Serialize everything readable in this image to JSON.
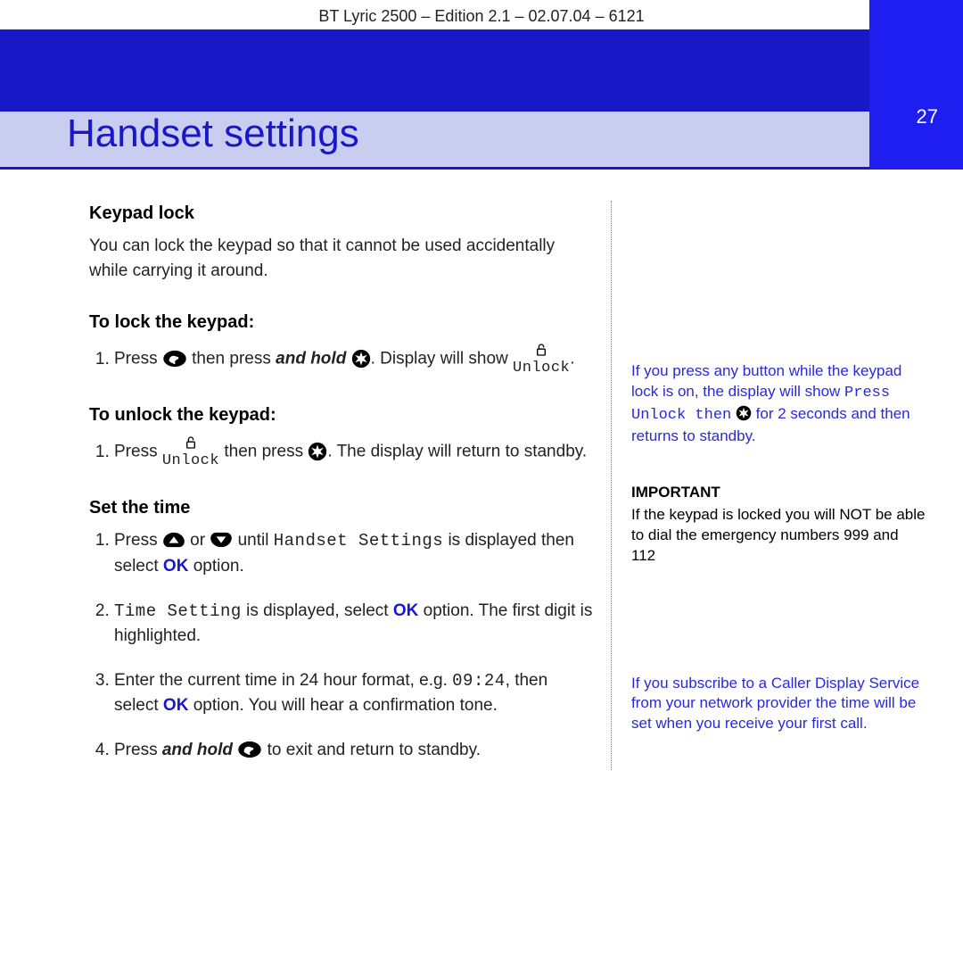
{
  "header_meta": "BT Lyric 2500 – Edition 2.1 – 02.07.04 – 6121",
  "page_title": "Handset settings",
  "page_number": "27",
  "main": {
    "keypad_lock_heading": "Keypad lock",
    "keypad_lock_para": "You can lock the keypad so that it cannot be used accidentally while carrying it around.",
    "to_lock_heading": "To lock the keypad:",
    "lock_step1_a": "Press ",
    "lock_step1_b": " then press ",
    "lock_step1_bi": "and hold",
    "lock_step1_c": " ",
    "lock_step1_d": ". Display will show ",
    "unlock_glyph_text": "Unlock",
    "lock_step1_end": ".",
    "to_unlock_heading": "To unlock the keypad:",
    "unlock_step1_a": "Press ",
    "unlock_step1_b": " then press ",
    "unlock_step1_c": ". The display will return to standby.",
    "set_time_heading": "Set the time",
    "time_step1_a": "Press ",
    "time_step1_or": " or ",
    "time_step1_b": " until ",
    "time_step1_disp": "Handset Settings",
    "time_step1_c": " is displayed then select ",
    "ok_label": "OK",
    "time_step1_d": " option.",
    "time_step2_disp": "Time Setting",
    "time_step2_a": " is displayed, select ",
    "time_step2_b": " option. The first digit is highlighted.",
    "time_step3_a": "Enter the current time in 24 hour format, e.g. ",
    "time_step3_time": "09:24",
    "time_step3_b": ", then select ",
    "time_step3_c": " option. You will hear a confirmation tone.",
    "time_step4_a": "Press ",
    "time_step4_bi": "and hold",
    "time_step4_b": " ",
    "time_step4_c": " to exit and return to standby."
  },
  "side": {
    "note1_a": "If you press any button while the keypad lock is on, the display will show ",
    "note1_mono": "Press Unlock then",
    "note1_b": " for 2 seconds and then returns to standby.",
    "important_label": "IMPORTANT",
    "important_body": "If the keypad is locked you will NOT be able to dial the emergency numbers 999 and 112",
    "note2": "If you subscribe to a Caller Display Service from your network provider the time will be set when you receive your first call."
  }
}
